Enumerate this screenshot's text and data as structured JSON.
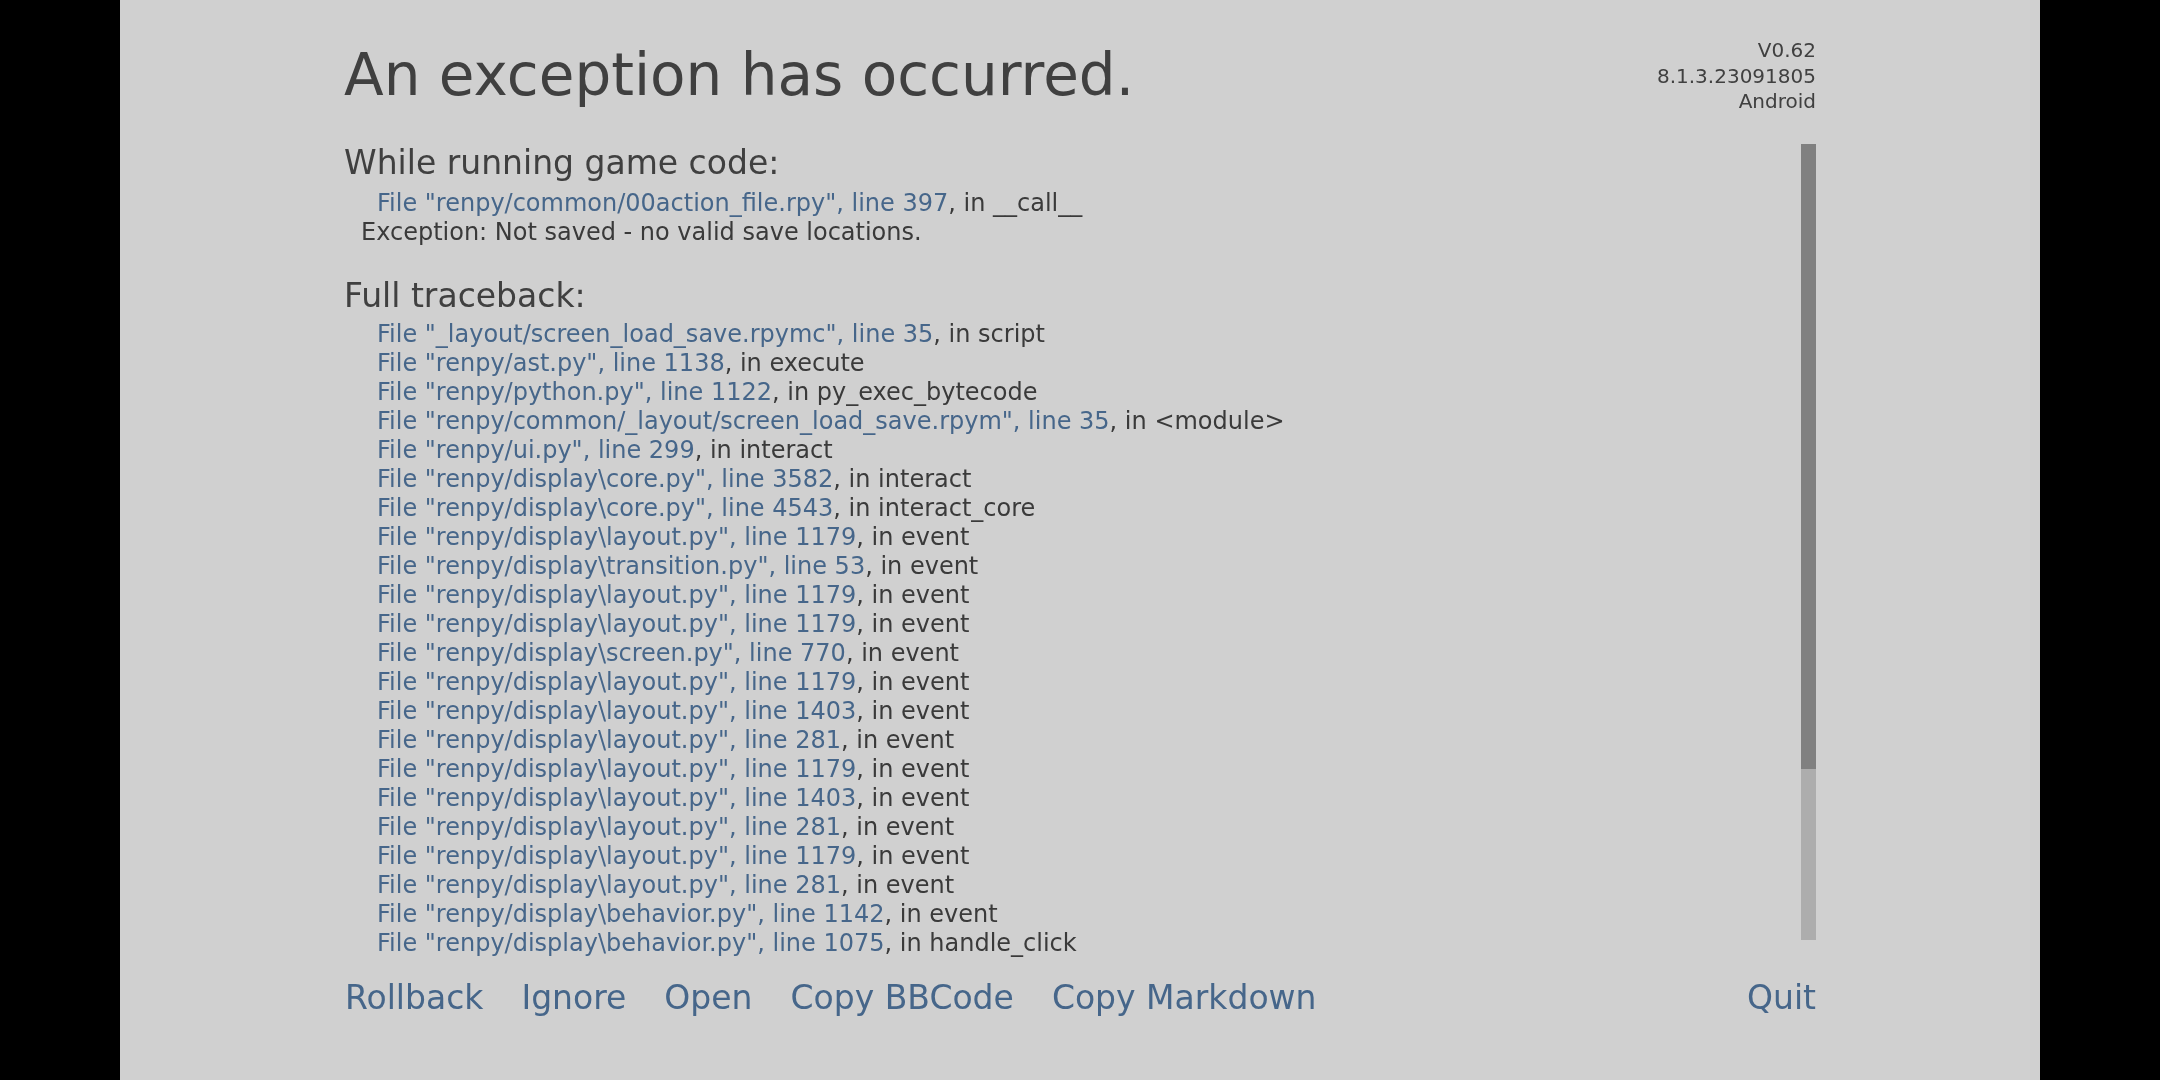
{
  "title": "An exception has occurred.",
  "version_info": [
    "V0.62",
    "8.1.3.23091805",
    "Android"
  ],
  "game_code": {
    "heading": "While running game code:",
    "frames": [
      {
        "location": "File \"renpy/common/00action_file.rpy\", line 397",
        "context": ", in __call__"
      }
    ],
    "exception": "Exception: Not saved - no valid save locations."
  },
  "full_traceback": {
    "heading": "Full traceback:",
    "frames": [
      {
        "location": "File \"_layout/screen_load_save.rpymc\", line 35",
        "context": ", in script"
      },
      {
        "location": "File \"renpy/ast.py\", line 1138",
        "context": ", in execute"
      },
      {
        "location": "File \"renpy/python.py\", line 1122",
        "context": ", in py_exec_bytecode"
      },
      {
        "location": "File \"renpy/common/_layout/screen_load_save.rpym\", line 35",
        "context": ", in <module>"
      },
      {
        "location": "File \"renpy/ui.py\", line 299",
        "context": ", in interact"
      },
      {
        "location": "File \"renpy/display\\core.py\", line 3582",
        "context": ", in interact"
      },
      {
        "location": "File \"renpy/display\\core.py\", line 4543",
        "context": ", in interact_core"
      },
      {
        "location": "File \"renpy/display\\layout.py\", line 1179",
        "context": ", in event"
      },
      {
        "location": "File \"renpy/display\\transition.py\", line 53",
        "context": ", in event"
      },
      {
        "location": "File \"renpy/display\\layout.py\", line 1179",
        "context": ", in event"
      },
      {
        "location": "File \"renpy/display\\layout.py\", line 1179",
        "context": ", in event"
      },
      {
        "location": "File \"renpy/display\\screen.py\", line 770",
        "context": ", in event"
      },
      {
        "location": "File \"renpy/display\\layout.py\", line 1179",
        "context": ", in event"
      },
      {
        "location": "File \"renpy/display\\layout.py\", line 1403",
        "context": ", in event"
      },
      {
        "location": "File \"renpy/display\\layout.py\", line 281",
        "context": ", in event"
      },
      {
        "location": "File \"renpy/display\\layout.py\", line 1179",
        "context": ", in event"
      },
      {
        "location": "File \"renpy/display\\layout.py\", line 1403",
        "context": ", in event"
      },
      {
        "location": "File \"renpy/display\\layout.py\", line 281",
        "context": ", in event"
      },
      {
        "location": "File \"renpy/display\\layout.py\", line 1179",
        "context": ", in event"
      },
      {
        "location": "File \"renpy/display\\layout.py\", line 281",
        "context": ", in event"
      },
      {
        "location": "File \"renpy/display\\behavior.py\", line 1142",
        "context": ", in event"
      },
      {
        "location": "File \"renpy/display\\behavior.py\", line 1075",
        "context": ", in handle_click"
      }
    ]
  },
  "buttons": [
    {
      "label": "Rollback"
    },
    {
      "label": "Ignore"
    },
    {
      "label": "Open"
    },
    {
      "label": "Copy BBCode"
    },
    {
      "label": "Copy Markdown"
    }
  ],
  "quit_button": {
    "label": "Quit"
  }
}
